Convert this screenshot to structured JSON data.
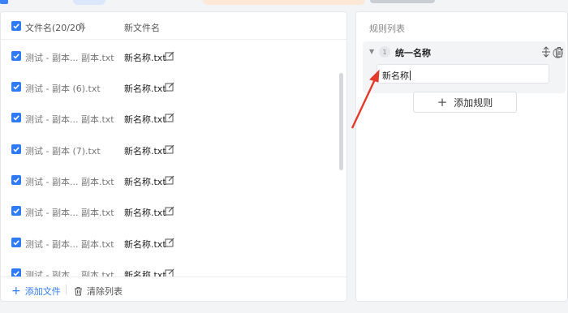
{
  "colors": {
    "accent": "#2f7bf5",
    "annotation_arrow": "#e53a2b"
  },
  "file_list": {
    "header": {
      "name_label": "文件名(20/20)",
      "new_name_label": "新文件名",
      "sort_icon": "sort-icon"
    },
    "rows": [
      {
        "old_name": "测试 - 副本... 副本.txt",
        "new_name": "新名称.txt"
      },
      {
        "old_name": "测试 - 副本 (6).txt",
        "new_name": "新名称.txt"
      },
      {
        "old_name": "测试 - 副本... 副本.txt",
        "new_name": "新名称.txt"
      },
      {
        "old_name": "测试 - 副本 (7).txt",
        "new_name": "新名称.txt"
      },
      {
        "old_name": "测试 - 副本... 副本.txt",
        "new_name": "新名称.txt"
      },
      {
        "old_name": "测试 - 副本... 副本.txt",
        "new_name": "新名称.txt"
      },
      {
        "old_name": "测试 - 副本... 副本.txt",
        "new_name": "新名称.txt"
      },
      {
        "old_name": "测试 - 副本... 副本.txt",
        "new_name": "新名称.txt"
      }
    ],
    "footer": {
      "add_file": "添加文件",
      "clear_list": "清除列表"
    }
  },
  "rules": {
    "title": "规则列表",
    "items": [
      {
        "index": "1",
        "name": "统一名称",
        "input_value": "新名称"
      }
    ],
    "add_rule": "添加规则"
  }
}
